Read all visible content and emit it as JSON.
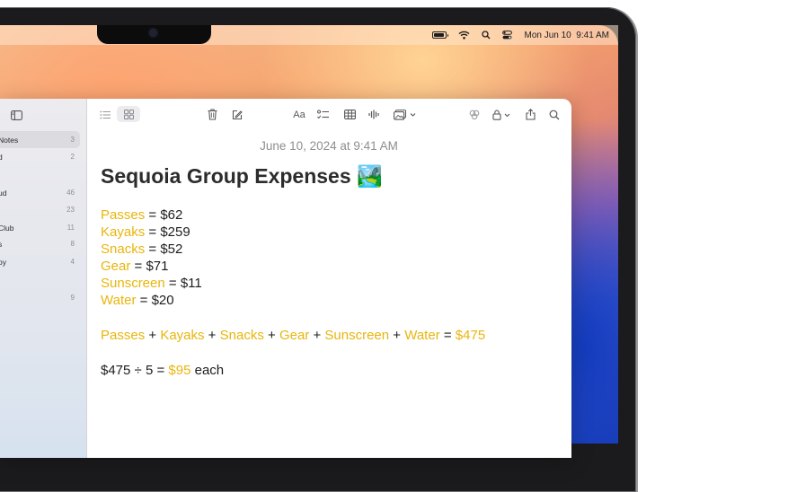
{
  "menubar": {
    "datetime": "Mon Jun 10  9:41 AM",
    "icons": [
      "battery-icon",
      "wifi-icon",
      "spotlight-search-icon",
      "control-center-icon"
    ]
  },
  "sidebar": {
    "items": [
      {
        "label": "Notes",
        "count": "3",
        "active": true
      },
      {
        "label": "d",
        "count": "2"
      },
      {
        "label": "ud",
        "count": "46"
      },
      {
        "label": "",
        "count": "23"
      },
      {
        "label": "Club",
        "count": "11"
      },
      {
        "label": "s",
        "count": "8"
      },
      {
        "label": "oy",
        "count": "4"
      },
      {
        "label": "",
        "count": "9"
      }
    ]
  },
  "toolbar": {
    "icons": [
      "list-view-icon",
      "gallery-view-icon",
      "trash-icon",
      "compose-icon",
      "format-text-icon",
      "checklist-icon",
      "table-icon",
      "audio-icon",
      "media-icon",
      "collaborate-icon",
      "lock-icon",
      "share-icon",
      "search-icon"
    ],
    "format_label": "Aa"
  },
  "note": {
    "date": "June 10, 2024 at 9:41 AM",
    "title": "Sequoia Group Expenses",
    "title_emoji": "🏞️",
    "expenses": [
      {
        "name": "Passes",
        "value": "$62"
      },
      {
        "name": "Kayaks",
        "value": "$259"
      },
      {
        "name": "Snacks",
        "value": "$52"
      },
      {
        "name": "Gear",
        "value": "$71"
      },
      {
        "name": "Sunscreen",
        "value": "$11"
      },
      {
        "name": "Water",
        "value": "$20"
      }
    ],
    "sum_total": "$475",
    "division": {
      "total": "$475",
      "operator": "÷",
      "divisor": "5",
      "equals": "=",
      "result": "$95",
      "suffix": "each"
    },
    "colors": {
      "highlight": "#e9b50c",
      "text": "#1d1d1f"
    }
  }
}
